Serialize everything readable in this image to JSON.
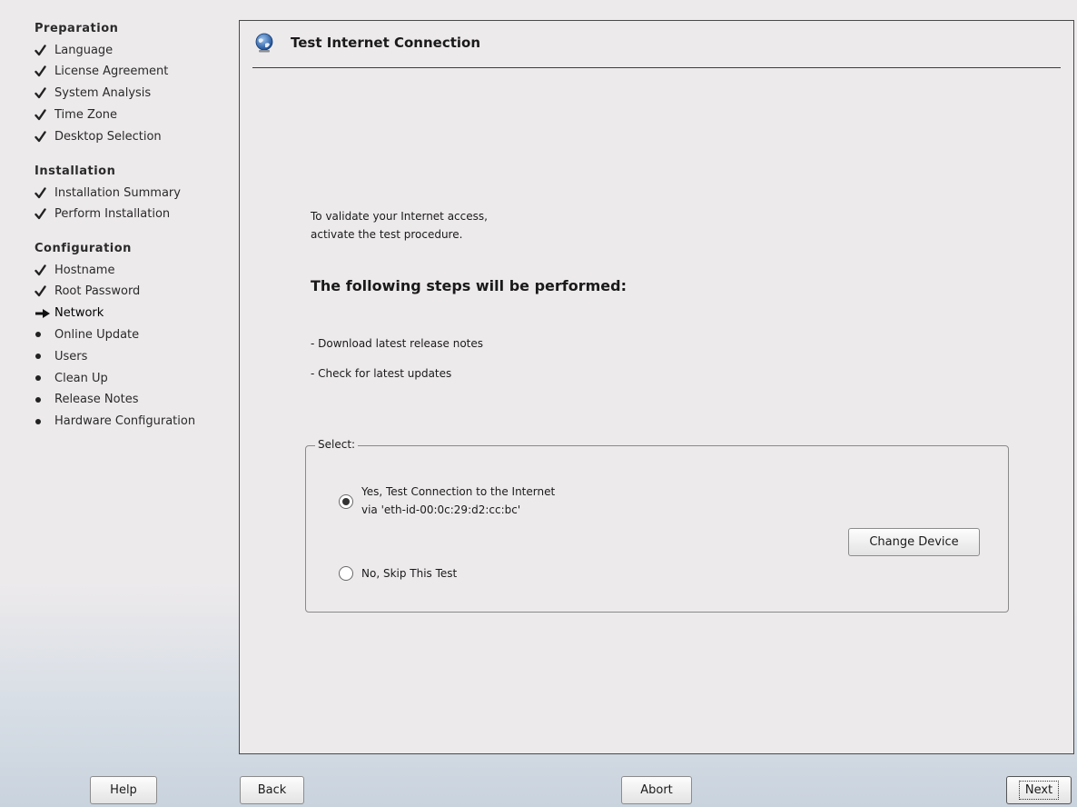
{
  "sidebar": {
    "sections": [
      {
        "title": "Preparation",
        "steps": [
          {
            "label": "Language",
            "status": "done"
          },
          {
            "label": "License Agreement",
            "status": "done"
          },
          {
            "label": "System Analysis",
            "status": "done"
          },
          {
            "label": "Time Zone",
            "status": "done"
          },
          {
            "label": "Desktop Selection",
            "status": "done"
          }
        ]
      },
      {
        "title": "Installation",
        "steps": [
          {
            "label": "Installation Summary",
            "status": "done"
          },
          {
            "label": "Perform Installation",
            "status": "done"
          }
        ]
      },
      {
        "title": "Configuration",
        "steps": [
          {
            "label": "Hostname",
            "status": "done"
          },
          {
            "label": "Root Password",
            "status": "done"
          },
          {
            "label": "Network",
            "status": "current"
          },
          {
            "label": "Online Update",
            "status": "pending"
          },
          {
            "label": "Users",
            "status": "pending"
          },
          {
            "label": "Clean Up",
            "status": "pending"
          },
          {
            "label": "Release Notes",
            "status": "pending"
          },
          {
            "label": "Hardware Configuration",
            "status": "pending"
          }
        ]
      }
    ]
  },
  "main": {
    "title": "Test Internet Connection",
    "title_icon": "globe-icon",
    "intro_line1": "To validate your Internet access,",
    "intro_line2": "activate the test procedure.",
    "steps_heading": "The following steps will be performed:",
    "step_items": [
      "- Download latest release notes",
      "- Check for latest updates"
    ],
    "select": {
      "legend": "Select:",
      "option_yes_line1": "Yes, Test Connection to the Internet",
      "option_yes_line2": "via 'eth-id-00:0c:29:d2:cc:bc'",
      "option_no": "No, Skip This Test",
      "selected": "yes",
      "change_device_label": "Change Device"
    }
  },
  "buttons": {
    "help": "Help",
    "back": "Back",
    "abort": "Abort",
    "next": "Next"
  },
  "colors": {
    "background": "#edeaec",
    "panel_border": "#4a4a4a"
  }
}
